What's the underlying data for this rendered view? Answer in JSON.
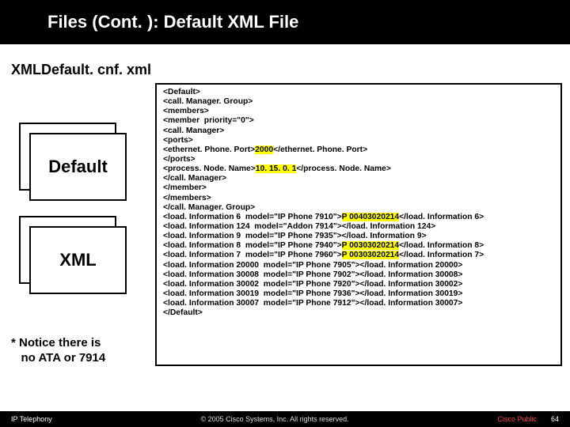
{
  "title": "Files (Cont. ): Default XML File",
  "subtitle": "XMLDefault. cnf. xml",
  "fileicon": {
    "label1": "Default",
    "label2": "XML"
  },
  "note": "* Notice there is\n   no ATA or 7914",
  "xml": {
    "l1": "<Default>",
    "l2": "<call. Manager. Group>",
    "l3": "<members>",
    "l4": "<member  priority=\"0\">",
    "l5": "<call. Manager>",
    "l6": "<ports>",
    "l7a": "<ethernet. Phone. Port>",
    "l7b": "2000",
    "l7c": "</ethernet. Phone. Port>",
    "l8": "</ports>",
    "l9a": "<process. Node. Name>",
    "l9b": "10. 15. 0. 1",
    "l9c": "</process. Node. Name>",
    "l10": "</call. Manager>",
    "l11": "</member>",
    "l12": "</members>",
    "l13": "</call. Manager. Group>",
    "l14a": "<load. Information 6  model=\"IP Phone 7910\">",
    "l14b": "P 00403020214",
    "l14c": "</load. Information 6>",
    "l15": "<load. Information 124  model=\"Addon 7914\"></load. Information 124>",
    "l16": "<load. Information 9  model=\"IP Phone 7935\"></load. Information 9>",
    "l17a": "<load. Information 8  model=\"IP Phone 7940\">",
    "l17b": "P 00303020214",
    "l17c": "</load. Information 8>",
    "l18a": "<load. Information 7  model=\"IP Phone 7960\">",
    "l18b": "P 00303020214",
    "l18c": "</load. Information 7>",
    "l19": "<load. Information 20000  model=\"IP Phone 7905\"></load. Information 20000>",
    "l20": "<load. Information 30008  model=\"IP Phone 7902\"></load. Information 30008>",
    "l21": "<load. Information 30002  model=\"IP Phone 7920\"></load. Information 30002>",
    "l22": "<load. Information 30019  model=\"IP Phone 7936\"></load. Information 30019>",
    "l23": "<load. Information 30007  model=\"IP Phone 7912\"></load. Information 30007>",
    "l24": "</Default>"
  },
  "footer": {
    "left": "IP Telephony",
    "center": "© 2005 Cisco Systems, Inc. All rights reserved.",
    "right": "Cisco Public",
    "num": "64"
  }
}
